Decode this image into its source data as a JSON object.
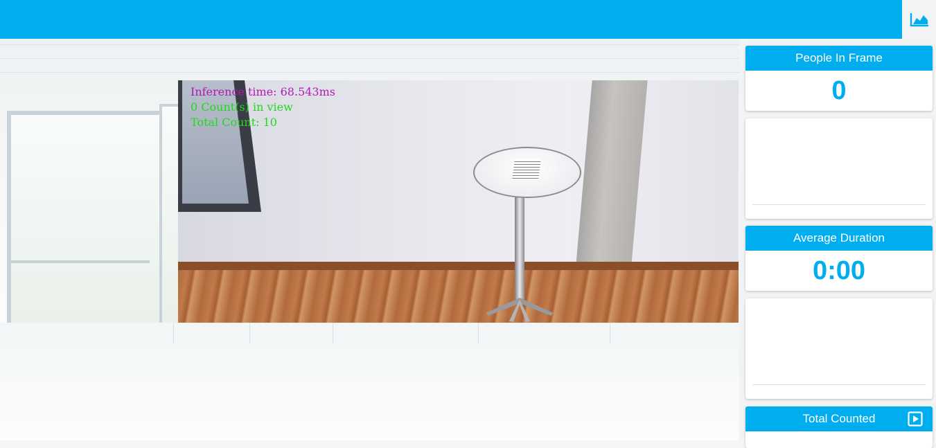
{
  "header": {
    "chart_toggle_icon": "area-chart-icon",
    "accent_color": "#00aeef"
  },
  "video": {
    "inference_text": "Inference time: 68.543ms",
    "in_view_text": "0 Count(s) in view",
    "total_text": "Total Count: 10"
  },
  "stats": {
    "people_in_frame": {
      "title": "People In Frame",
      "value": "0"
    },
    "average_duration": {
      "title": "Average Duration",
      "value": "0:00"
    },
    "total_counted": {
      "title": "Total Counted",
      "icon": "play-icon"
    }
  }
}
